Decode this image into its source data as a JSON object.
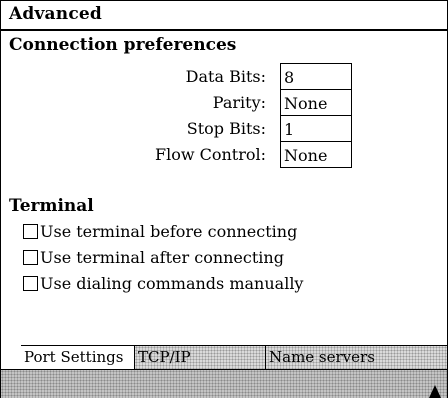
{
  "window": {
    "title": "Advanced"
  },
  "connection": {
    "heading": "Connection preferences",
    "fields": [
      {
        "label": "Data Bits:",
        "value": "8"
      },
      {
        "label": "Parity:",
        "value": "None"
      },
      {
        "label": "Stop Bits:",
        "value": "1"
      },
      {
        "label": "Flow Control:",
        "value": "None"
      }
    ]
  },
  "terminal": {
    "heading": "Terminal",
    "options": [
      {
        "label": "Use terminal before connecting",
        "checked": false
      },
      {
        "label": "Use terminal after connecting",
        "checked": false
      },
      {
        "label": "Use dialing commands manually",
        "checked": false
      }
    ]
  },
  "tabs": [
    {
      "label": "Port Settings",
      "active": true
    },
    {
      "label": "TCP/IP",
      "active": false
    },
    {
      "label": "Name servers",
      "active": false
    }
  ],
  "statusbar": {
    "scroll_icon": "up-arrow-icon"
  }
}
